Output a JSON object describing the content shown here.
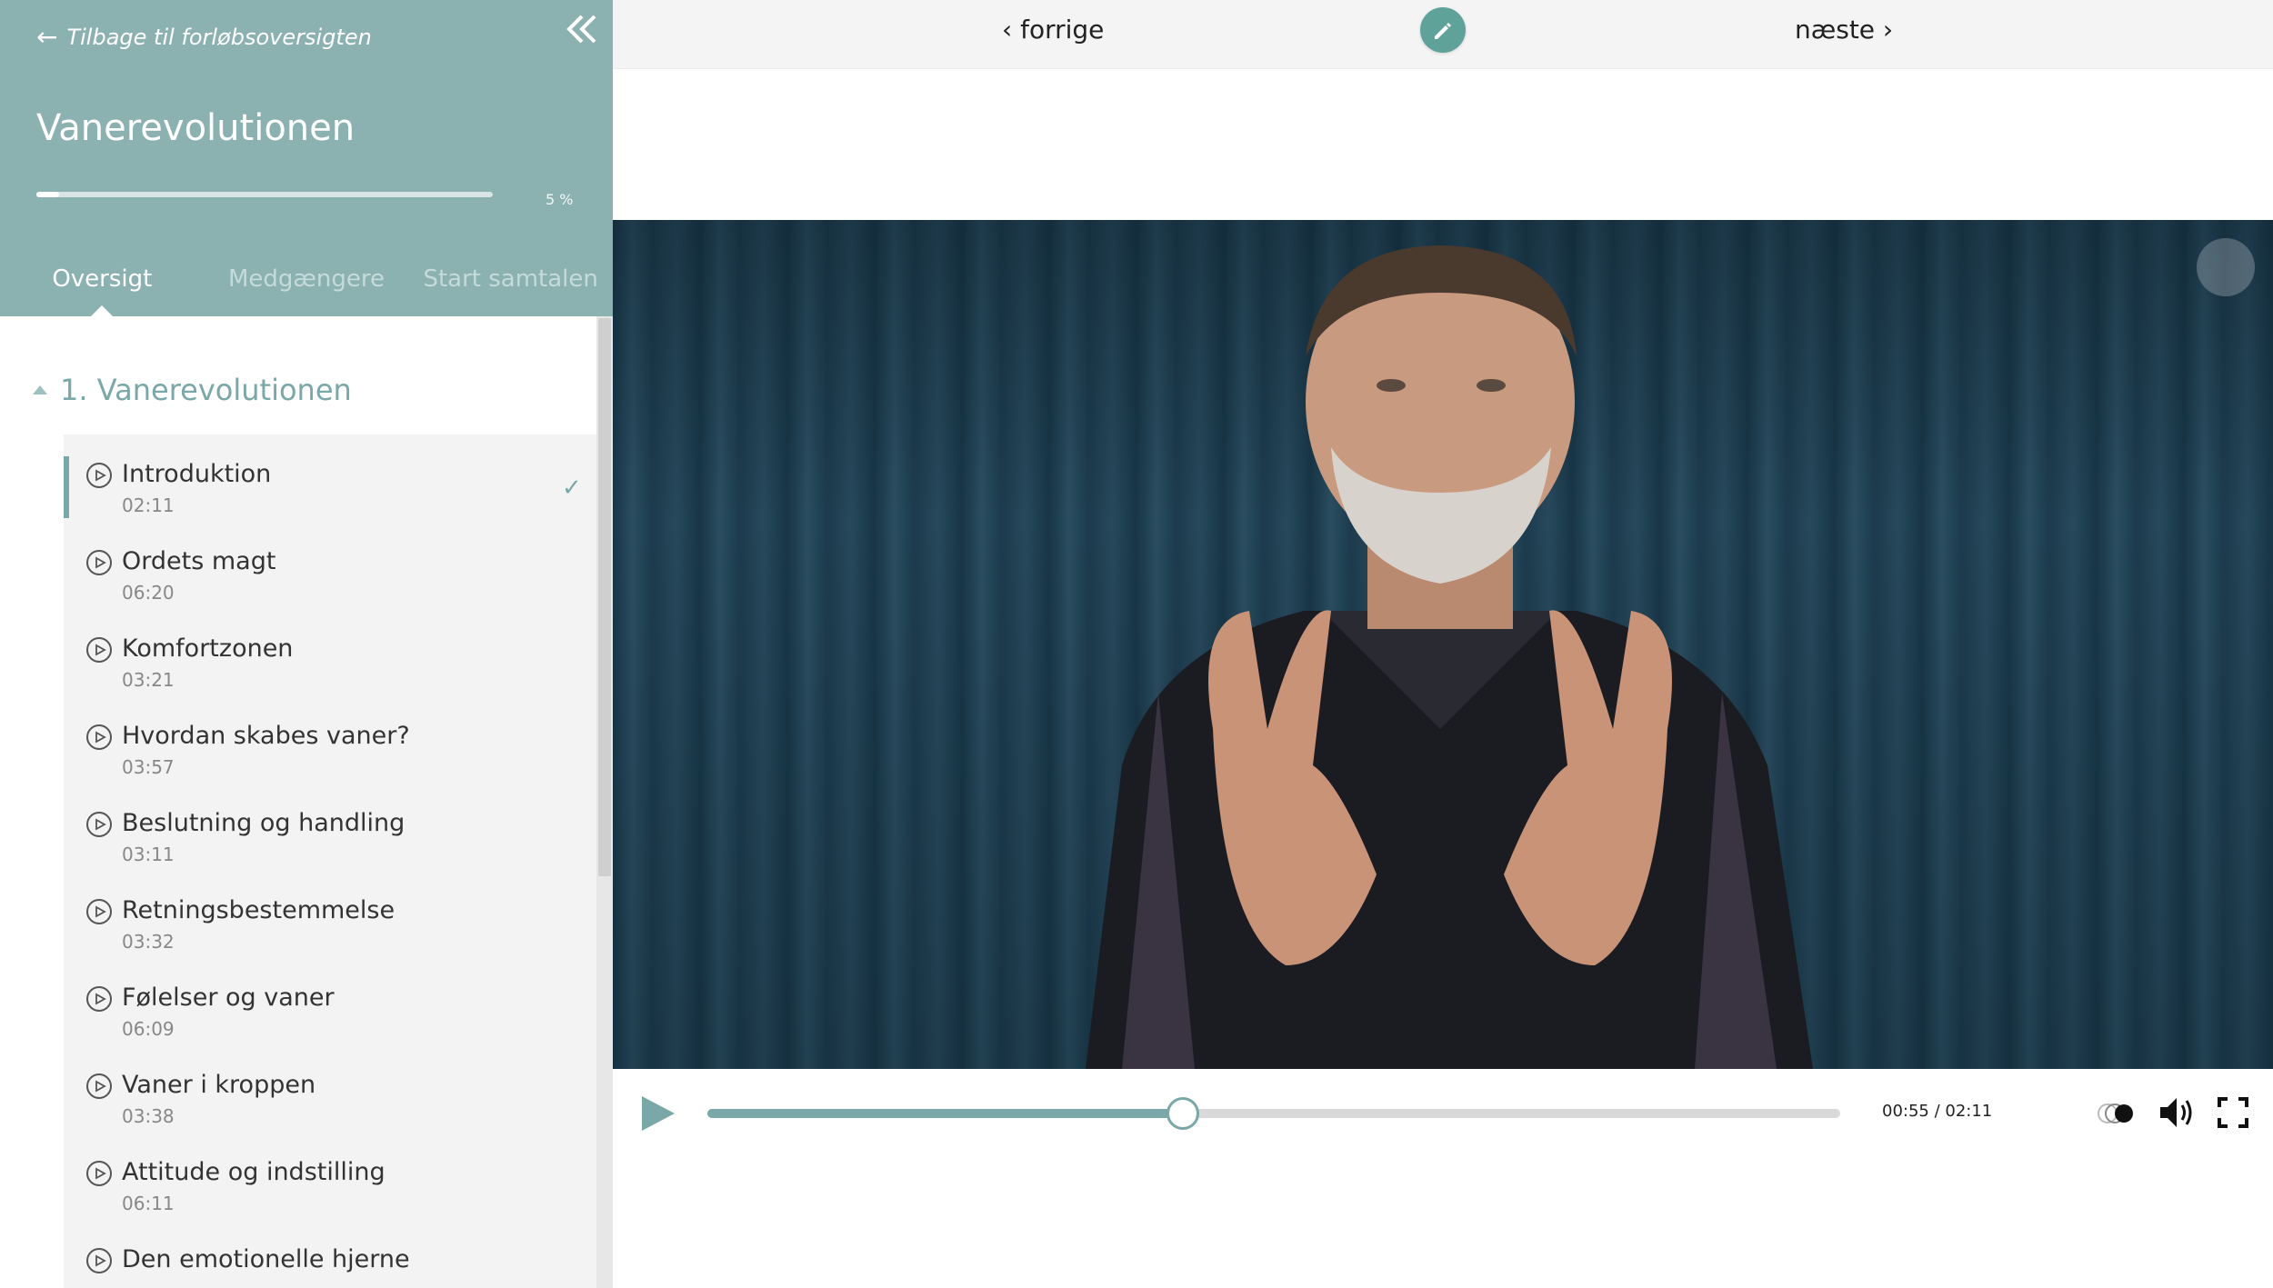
{
  "sidebar": {
    "back_label": "Tilbage til forløbsoversigten",
    "course_title": "Vanerevolutionen",
    "progress": 5,
    "progress_label": "5 %",
    "tabs": [
      {
        "label": "Oversigt",
        "active": true
      },
      {
        "label": "Medgængere",
        "active": false
      },
      {
        "label": "Start samtalen",
        "active": false
      }
    ],
    "section_title": "1. Vanerevolutionen",
    "lessons": [
      {
        "title": "Introduktion",
        "duration": "02:11",
        "completed": true
      },
      {
        "title": "Ordets magt",
        "duration": "06:20"
      },
      {
        "title": "Komfortzonen",
        "duration": "03:21"
      },
      {
        "title": "Hvordan skabes vaner?",
        "duration": "03:57"
      },
      {
        "title": "Beslutning og handling",
        "duration": "03:11"
      },
      {
        "title": "Retningsbestemmelse",
        "duration": "03:32"
      },
      {
        "title": "Følelser og vaner",
        "duration": "06:09"
      },
      {
        "title": "Vaner i kroppen",
        "duration": "03:38"
      },
      {
        "title": "Attitude og indstilling",
        "duration": "06:11"
      },
      {
        "title": "Den emotionelle hjerne",
        "duration": ""
      }
    ],
    "check_mark": "✓"
  },
  "topbar": {
    "prev_label": "‹ forrige",
    "next_label": "næste ›",
    "edit_icon": "pencil-icon"
  },
  "player": {
    "current_time": "00:55",
    "total_time": "02:11",
    "time_label": "00:55 / 02:11",
    "played_fraction": 0.4198
  },
  "colors": {
    "accent": "#7aa7a7",
    "sidebar_header": "#8cb1b1",
    "edit_button": "#5fa29a"
  }
}
